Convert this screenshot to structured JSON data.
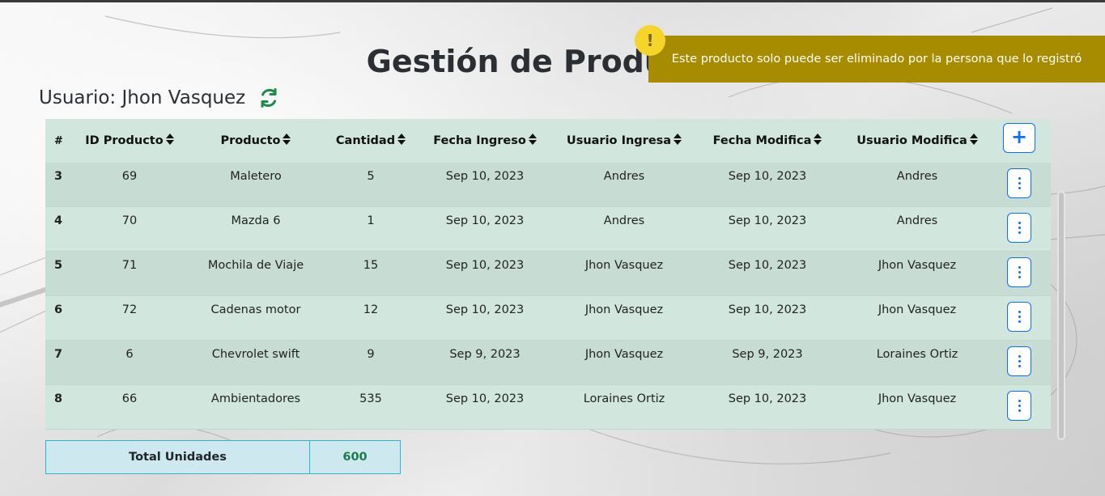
{
  "page": {
    "title": "Gestión de Productos",
    "user_label": "Usuario: Jhon Vasquez"
  },
  "toast": {
    "message": "Este producto solo puede ser eliminado por la persona que lo registró",
    "icon": "exclamation-icon",
    "color": "#a88c00"
  },
  "table": {
    "columns": {
      "num": "#",
      "id": "ID Producto",
      "product": "Producto",
      "qty": "Cantidad",
      "date_in": "Fecha Ingreso",
      "user_in": "Usuario Ingresa",
      "date_mod": "Fecha Modifica",
      "user_mod": "Usuario Modifica"
    },
    "add_label": "+",
    "rows": [
      {
        "num": "3",
        "id": "69",
        "product": "Maletero",
        "qty": "5",
        "date_in": "Sep 10, 2023",
        "user_in": "Andres",
        "date_mod": "Sep 10, 2023",
        "user_mod": "Andres"
      },
      {
        "num": "4",
        "id": "70",
        "product": "Mazda 6",
        "qty": "1",
        "date_in": "Sep 10, 2023",
        "user_in": "Andres",
        "date_mod": "Sep 10, 2023",
        "user_mod": "Andres"
      },
      {
        "num": "5",
        "id": "71",
        "product": "Mochila de Viaje",
        "qty": "15",
        "date_in": "Sep 10, 2023",
        "user_in": "Jhon Vasquez",
        "date_mod": "Sep 10, 2023",
        "user_mod": "Jhon Vasquez"
      },
      {
        "num": "6",
        "id": "72",
        "product": "Cadenas motor",
        "qty": "12",
        "date_in": "Sep 10, 2023",
        "user_in": "Jhon Vasquez",
        "date_mod": "Sep 10, 2023",
        "user_mod": "Jhon Vasquez"
      },
      {
        "num": "7",
        "id": "6",
        "product": "Chevrolet swift",
        "qty": "9",
        "date_in": "Sep 9, 2023",
        "user_in": "Jhon Vasquez",
        "date_mod": "Sep 9, 2023",
        "user_mod": "Loraines Ortiz"
      },
      {
        "num": "8",
        "id": "66",
        "product": "Ambientadores",
        "qty": "535",
        "date_in": "Sep 10, 2023",
        "user_in": "Loraines Ortiz",
        "date_mod": "Sep 10, 2023",
        "user_mod": "Jhon Vasquez"
      }
    ]
  },
  "total": {
    "label": "Total Unidades",
    "value": "600"
  },
  "colors": {
    "accent": "#0d6efd",
    "table_bg": "#d1e7dd",
    "total_border": "#29b6d1",
    "refresh_icon": "#1f8a4c"
  }
}
